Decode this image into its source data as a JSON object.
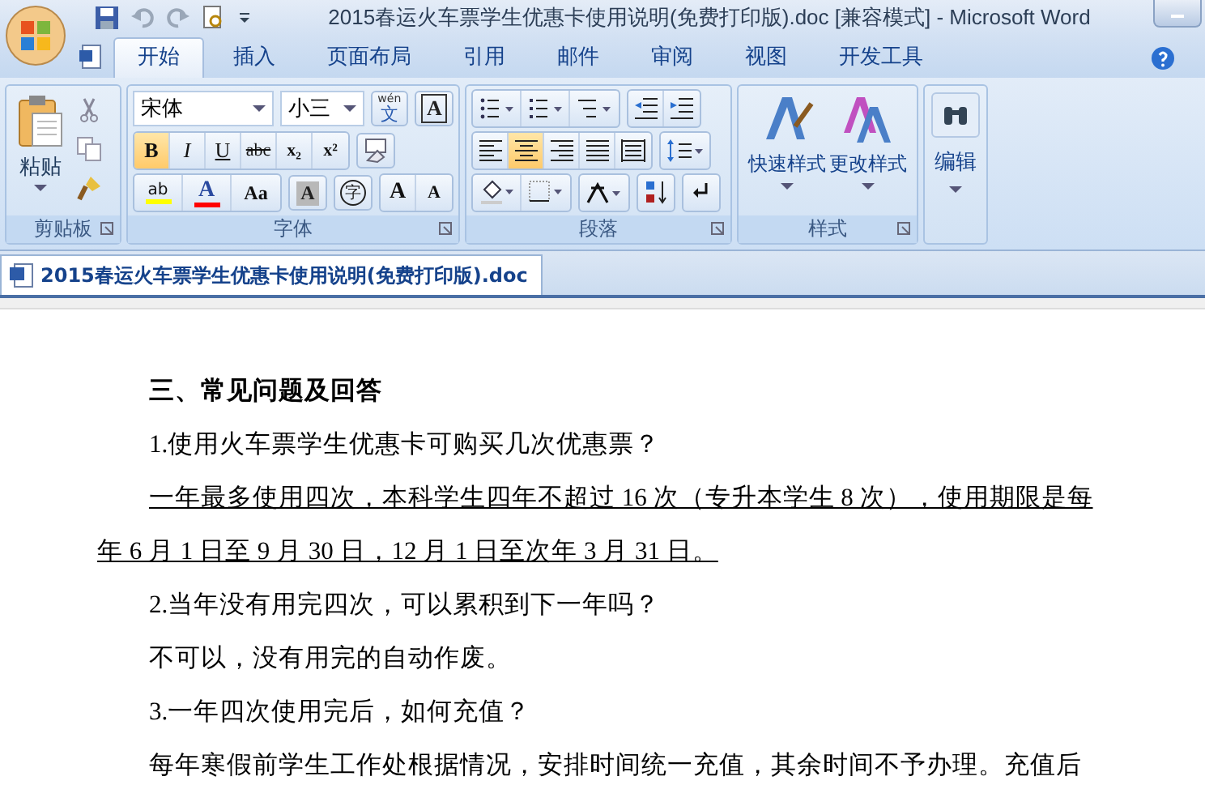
{
  "title_bar": {
    "title": "2015春运火车票学生优惠卡使用说明(免费打印版).doc [兼容模式] - Microsoft Word"
  },
  "tabs": [
    {
      "label": "开始",
      "selected": true
    },
    {
      "label": "插入",
      "selected": false
    },
    {
      "label": "页面布局",
      "selected": false
    },
    {
      "label": "引用",
      "selected": false
    },
    {
      "label": "邮件",
      "selected": false
    },
    {
      "label": "审阅",
      "selected": false
    },
    {
      "label": "视图",
      "selected": false
    },
    {
      "label": "开发工具",
      "selected": false
    }
  ],
  "ribbon": {
    "clipboard": {
      "label": "剪贴板",
      "paste": "粘贴"
    },
    "font": {
      "label": "字体",
      "font_name": "宋体",
      "font_size": "小三",
      "phonetic_ruby": "wén",
      "phonetic_base": "文",
      "border_char": "A",
      "format_buttons": [
        {
          "label": "B",
          "selected": true
        },
        {
          "label": "I",
          "selected": false
        },
        {
          "label": "U",
          "selected": false
        },
        {
          "label": "abc",
          "selected": false
        },
        {
          "label": "x₂",
          "selected": false
        },
        {
          "label": "x²",
          "selected": false
        }
      ],
      "highlight": "ab",
      "font_color_char": "A",
      "case_button": "Aa",
      "shading_char": "A",
      "enclose_char": "字",
      "grow_char": "A",
      "shrink_char": "A"
    },
    "paragraph": {
      "label": "段落",
      "alignments": [
        {
          "selected": false
        },
        {
          "selected": true
        },
        {
          "selected": false
        },
        {
          "selected": false
        },
        {
          "selected": false
        }
      ]
    },
    "styles": {
      "label": "样式",
      "buttons": [
        "快速样式",
        "更改样式"
      ]
    },
    "editing": {
      "label": "编辑"
    }
  },
  "document_tab": {
    "label": "2015春运火车票学生优惠卡使用说明(免费打印版).doc"
  },
  "paragraphs": [
    {
      "kind": "heading",
      "text": "三、常见问题及回答",
      "underline": false
    },
    {
      "kind": "body",
      "text": "1.使用火车票学生优惠卡可购买几次优惠票？",
      "underline": false
    },
    {
      "kind": "body",
      "text": "一年最多使用四次，本科学生四年不超过 16 次（专升本学生 8 次），使用期限是每年 6 月 1 日至 9 月 30 日，12 月 1 日至次年 3 月 31 日。",
      "underline": true
    },
    {
      "kind": "body",
      "text": "2.当年没有用完四次，可以累积到下一年吗？",
      "underline": false
    },
    {
      "kind": "body",
      "text": "不可以，没有用完的自动作废。",
      "underline": false
    },
    {
      "kind": "body",
      "text": "3.一年四次使用完后，如何充值？",
      "underline": false
    },
    {
      "kind": "body",
      "text": "每年寒假前学生工作处根据情况，安排时间统一充值，其余时间不予办理。充值后",
      "underline": false
    }
  ]
}
